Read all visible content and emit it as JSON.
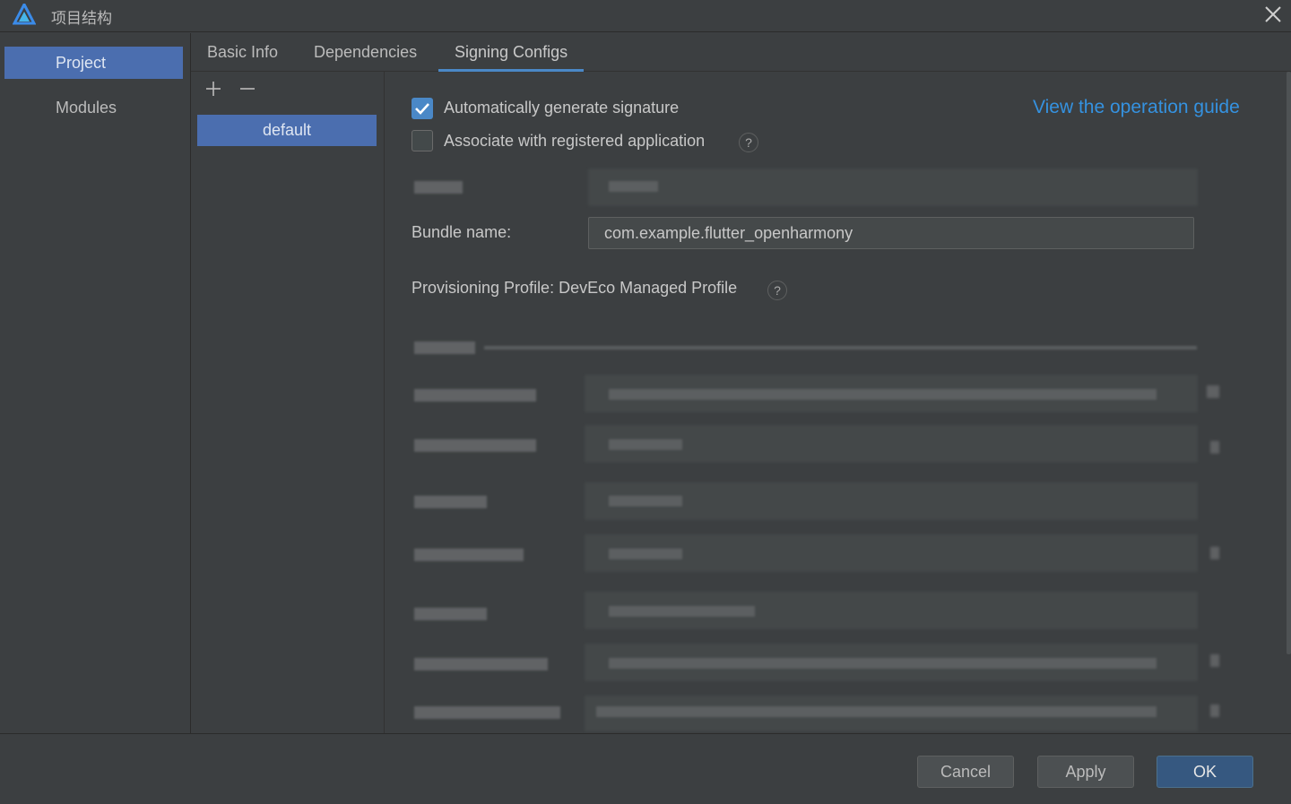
{
  "window": {
    "title": "项目结构",
    "close_icon": "close-icon",
    "logo": "deveco-logo-icon"
  },
  "nav": {
    "items": [
      {
        "label": "Project",
        "selected": true
      },
      {
        "label": "Modules",
        "selected": false
      }
    ]
  },
  "tabs": [
    {
      "label": "Basic Info",
      "active": false
    },
    {
      "label": "Dependencies",
      "active": false
    },
    {
      "label": "Signing Configs",
      "active": true
    }
  ],
  "toolbar": {
    "add_icon": "plus-icon",
    "remove_icon": "minus-icon"
  },
  "configs": [
    {
      "label": "default",
      "selected": true
    }
  ],
  "signing": {
    "auto_generate": {
      "label": "Automatically generate signature",
      "checked": true
    },
    "associate": {
      "label": "Associate with registered application",
      "checked": false,
      "help": "?"
    },
    "guide_link": "View the operation guide",
    "bundle_name": {
      "label": "Bundle name:",
      "value": "com.example.flutter_openharmony"
    },
    "provisioning": {
      "label": "Provisioning Profile: DevEco Managed Profile",
      "help": "?"
    }
  },
  "footer": {
    "cancel": "Cancel",
    "apply": "Apply",
    "ok": "OK"
  },
  "colors": {
    "accent": "#4a88c7",
    "selection": "#4b6eaf",
    "link": "#3592e0",
    "background": "#3c3f41"
  }
}
